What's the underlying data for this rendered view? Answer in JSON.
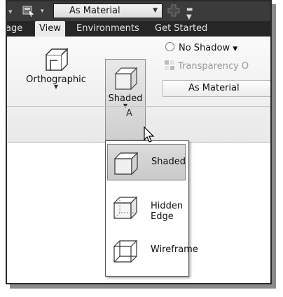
{
  "qat": {
    "material_value": "As Material"
  },
  "tabs": [
    {
      "label": "age"
    },
    {
      "label": "View"
    },
    {
      "label": "Environments"
    },
    {
      "label": "Get Started"
    }
  ],
  "ribbon": {
    "orthographic_label": "Orthographic",
    "shaded_label": "Shaded",
    "shadow_label": "No Shadow",
    "transparency_label": "Transparency O",
    "material_label": "As Material",
    "panel_label": "A"
  },
  "menu": {
    "items": [
      {
        "label": "Shaded",
        "icon": "shaded-cube-icon",
        "selected": true
      },
      {
        "label": "Hidden Edge",
        "icon": "hidden-edge-cube-icon",
        "selected": false
      },
      {
        "label": "Wireframe",
        "icon": "wireframe-cube-icon",
        "selected": false
      }
    ]
  },
  "colors": {
    "dark_bar": "#3b3b3b",
    "tab_bar": "#262626",
    "ribbon_bg": "#f2f2f2",
    "selected_bg": "#d0d0d0"
  }
}
